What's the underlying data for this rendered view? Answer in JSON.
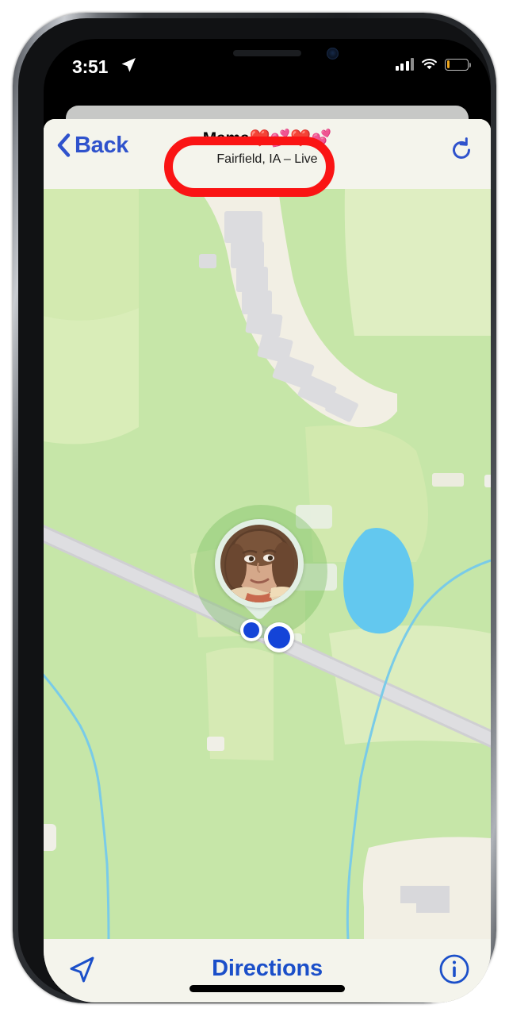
{
  "status_bar": {
    "time": "3:51",
    "location_arrow_icon": "location-arrow-icon",
    "cellular_icon": "cellular-signal-icon",
    "wifi_icon": "wifi-icon",
    "battery_icon": "battery-low-icon",
    "battery_fill_color": "#f0a81e"
  },
  "nav_bar": {
    "back_label": "Back",
    "back_chevron_icon": "chevron-left-icon",
    "title": "Mama❤️💕❤️💕",
    "subtitle": "Fairfield, IA – Live",
    "refresh_icon": "refresh-icon",
    "accent_color": "#2f52cc",
    "background_color": "#f4f4ec"
  },
  "annotation": {
    "shape": "oval",
    "color": "#fa1414",
    "target": "nav-title-block"
  },
  "map": {
    "park_green": "#c6e6a8",
    "park_green_light": "#d6ebb4",
    "field_pale": "#dfeec2",
    "road_beige": "#f2efe4",
    "road_gray": "#d6d6d8",
    "building_gray": "#dcdcdf",
    "water_blue": "#63c8ef",
    "stream_blue": "#79cbe8",
    "person_pin": {
      "label": "avatar-pin",
      "has_photo": true
    },
    "location_dots": [
      {
        "name": "location-dot-small",
        "color": "#1444d8"
      },
      {
        "name": "location-dot-large",
        "color": "#1444d8"
      }
    ]
  },
  "bottom_bar": {
    "nav_arrow_icon": "navigation-arrow-icon",
    "directions_label": "Directions",
    "info_icon": "info-circle-icon",
    "accent_color": "#1b4fc9",
    "background_color": "#f4f4ec"
  },
  "home_indicator": {
    "name": "home-indicator"
  }
}
